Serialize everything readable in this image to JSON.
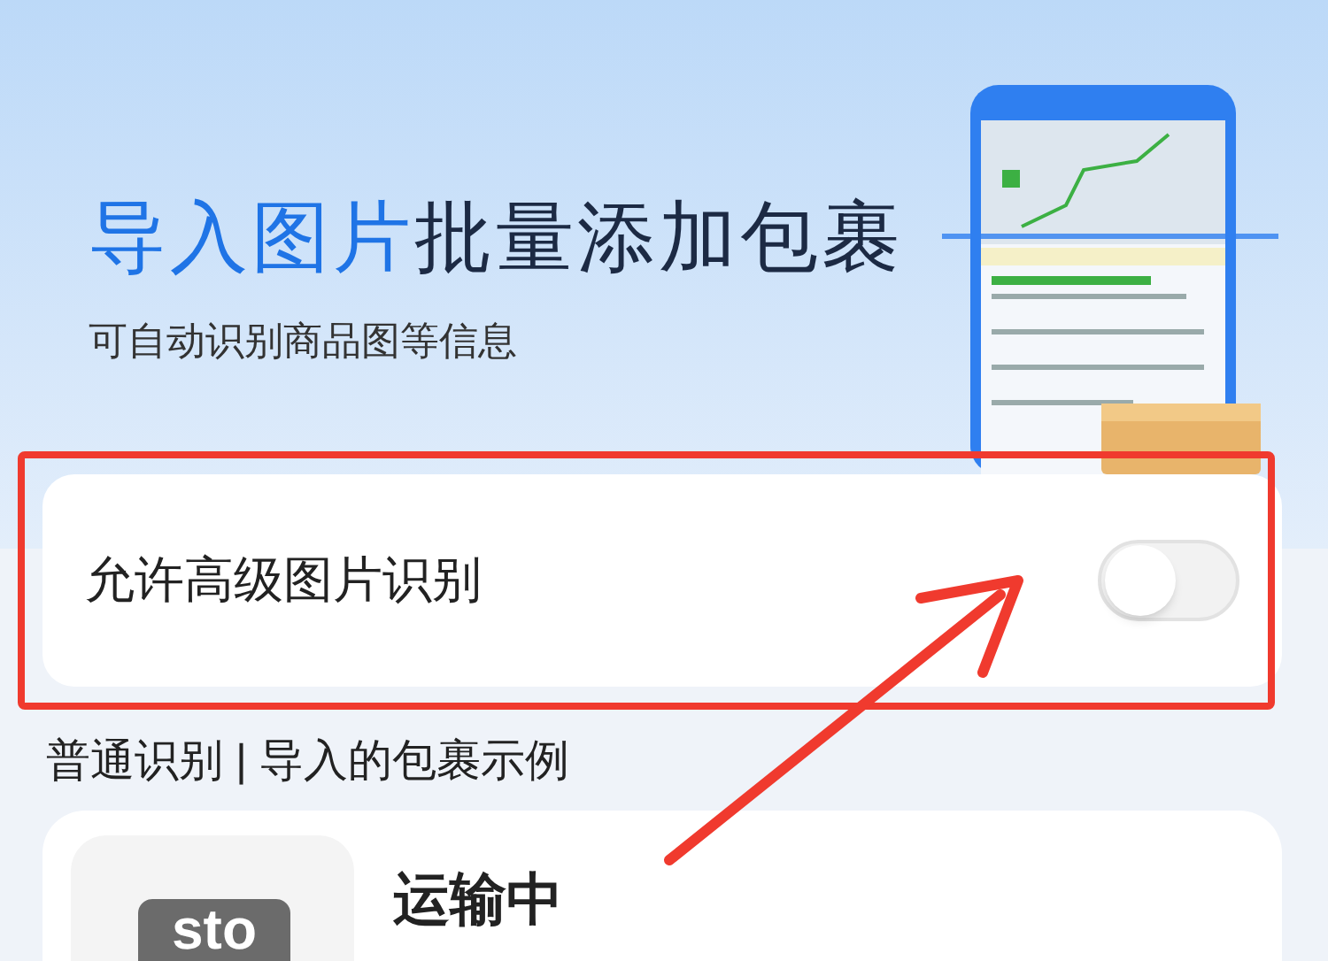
{
  "banner": {
    "title_highlight": "导入图片",
    "title_rest": "批量添加包裹",
    "subtitle": "可自动识别商品图等信息"
  },
  "setting": {
    "label": "允许高级图片识别",
    "on": false
  },
  "section_title": "普通识别 | 导入的包裹示例",
  "parcel": {
    "logo_text": "sto",
    "status": "运输中"
  }
}
